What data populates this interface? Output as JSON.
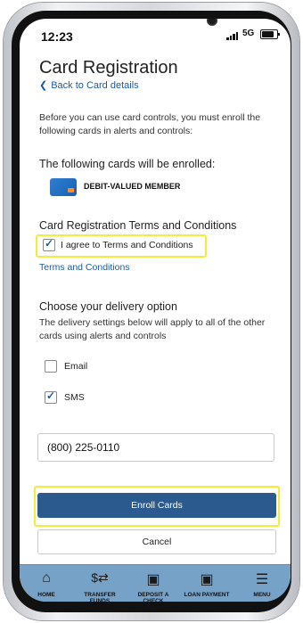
{
  "status_bar": {
    "time": "12:23",
    "network": "5G"
  },
  "header": {
    "title": "Card Registration",
    "back_link": "Back to Card details"
  },
  "intro": {
    "text": "Before you can use card controls, you must enroll the following cards in alerts and controls:"
  },
  "enroll_section": {
    "heading": "The following cards will be enrolled:",
    "card_name": "DEBIT-VALUED MEMBER"
  },
  "terms_section": {
    "heading": "Card Registration Terms and Conditions",
    "agree_label": "I agree to Terms and Conditions",
    "agree_checked": true,
    "terms_link": "Terms and Conditions"
  },
  "delivery_section": {
    "heading": "Choose your delivery option",
    "description": "The delivery settings below will apply to all of the other cards using alerts and controls",
    "options": [
      {
        "label": "Email",
        "checked": false
      },
      {
        "label": "SMS",
        "checked": true
      }
    ],
    "phone_value": "(800) 225-0110"
  },
  "actions": {
    "enroll_label": "Enroll Cards",
    "cancel_label": "Cancel"
  },
  "tabbar": {
    "items": [
      {
        "label": "HOME",
        "icon": "home-icon"
      },
      {
        "label": "TRANSFER FUNDS",
        "icon": "transfer-icon"
      },
      {
        "label": "DEPOSIT A CHECK",
        "icon": "camera-icon"
      },
      {
        "label": "LOAN PAYMENT",
        "icon": "camera-icon"
      },
      {
        "label": "MENU",
        "icon": "menu-icon"
      }
    ]
  },
  "colors": {
    "accent": "#1d5a9a",
    "primary_button": "#2b5a8f",
    "tabbar": "#77a2c8",
    "highlight": "#f3ec3b"
  }
}
